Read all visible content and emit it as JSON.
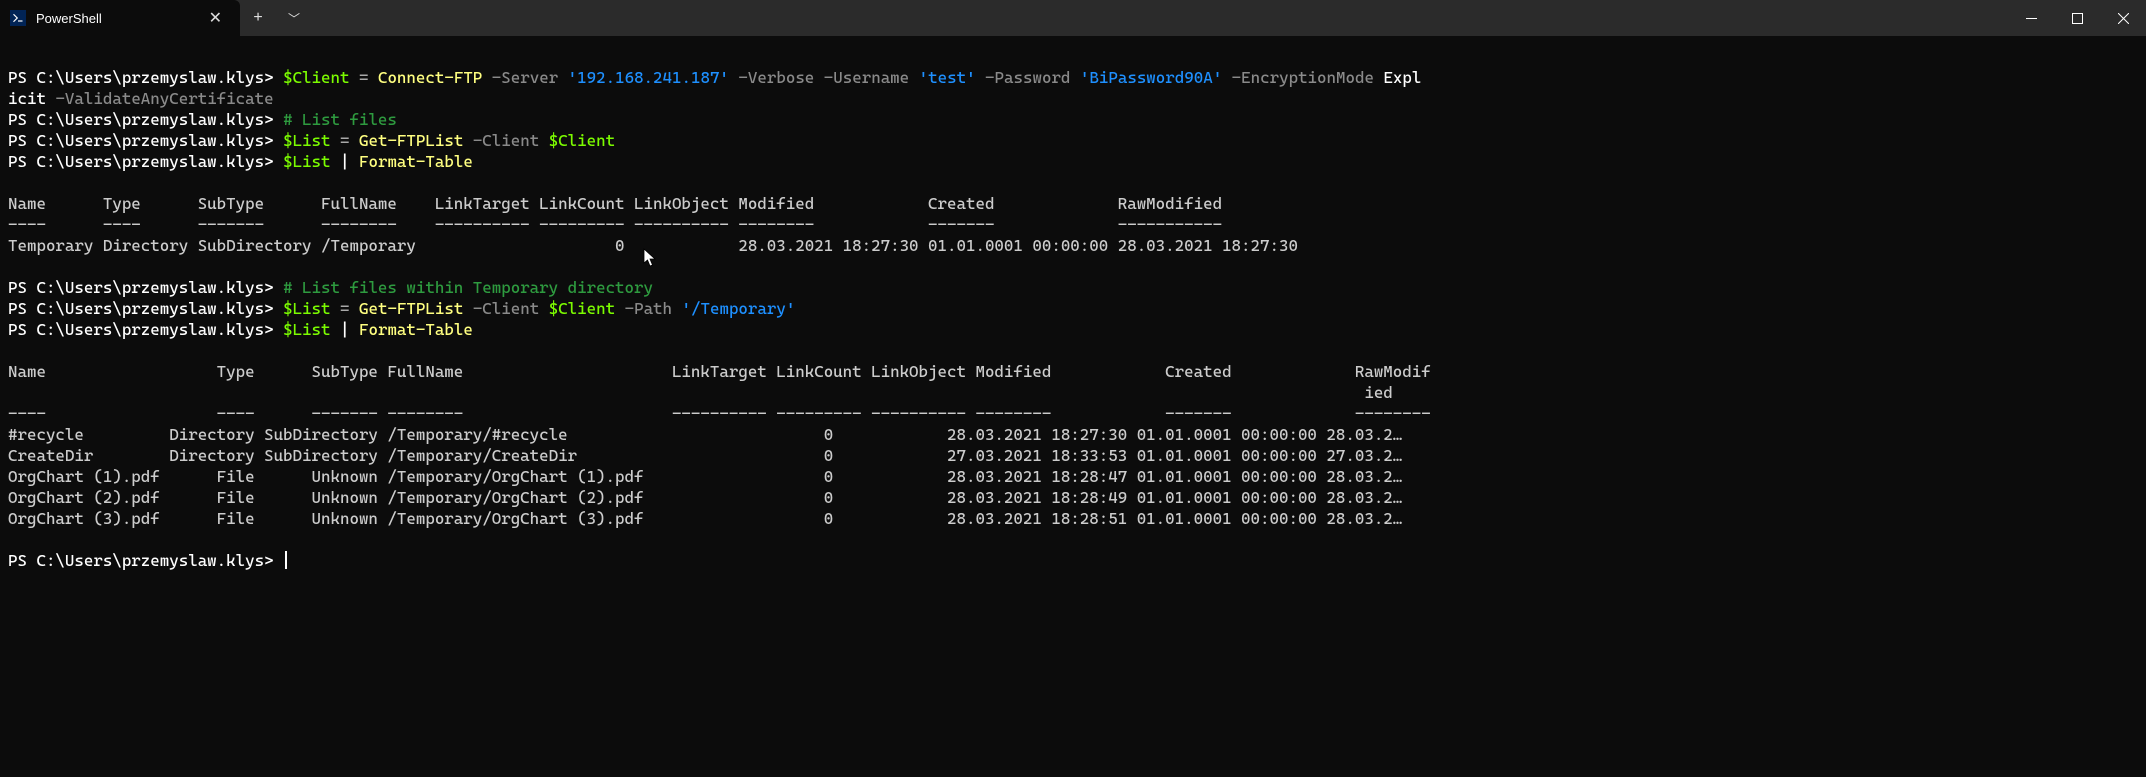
{
  "titlebar": {
    "tab_title": "PowerShell"
  },
  "prompt": "PS C:\\Users\\przemyslaw.klys>",
  "line1": {
    "var": "$Client",
    "eq": " = ",
    "cmd": "Connect-FTP",
    "p_server": " -Server ",
    "v_server": "'192.168.241.187'",
    "p_verbose": " -Verbose ",
    "p_user": "-Username ",
    "v_user": "'test'",
    "p_pass": " -Password ",
    "v_pass": "'BiPassword90A'",
    "p_enc": " -EncryptionMode ",
    "wrap1": "Expl",
    "wrap2": "icit",
    "p_validate": " -ValidateAnyCertificate"
  },
  "line2_comment": "# List files",
  "line3": {
    "var": "$List",
    "eq": " = ",
    "cmd": "Get-FTPList",
    "p_client": " -Client ",
    "v_client": "$Client"
  },
  "line4": {
    "var": "$List",
    "pipe": " | ",
    "cmd": "Format-Table"
  },
  "table1_header": "Name      Type      SubType      FullName    LinkTarget LinkCount LinkObject Modified            Created             RawModified",
  "table1_rule": "----      ----      -------      --------    ---------- --------- ---------- --------            -------             -----------",
  "table1_rows": [
    "Temporary Directory SubDirectory /Temporary                     0            28.03.2021 18:27:30 01.01.0001 00:00:00 28.03.2021 18:27:30"
  ],
  "line5_comment": "# List files within Temporary directory",
  "line6": {
    "var": "$List",
    "eq": " = ",
    "cmd": "Get-FTPList",
    "p_client": " -Client ",
    "v_client": "$Client",
    "p_path": " -Path ",
    "v_path": "'/Temporary'"
  },
  "line7": {
    "var": "$List",
    "pipe": " | ",
    "cmd": "Format-Table"
  },
  "table2_header": "Name                  Type      SubType FullName                      LinkTarget LinkCount LinkObject Modified            Created             RawModif\n                                                                                                                                               ied",
  "table2_rule": "----                  ----      ------- --------                      ---------- --------- ---------- --------            -------             --------",
  "table2_rows": [
    "#recycle         Directory SubDirectory /Temporary/#recycle                           0            28.03.2021 18:27:30 01.01.0001 00:00:00 28.03.2…",
    "CreateDir        Directory SubDirectory /Temporary/CreateDir                          0            27.03.2021 18:33:53 01.01.0001 00:00:00 27.03.2…",
    "OrgChart (1).pdf      File      Unknown /Temporary/OrgChart (1).pdf                   0            28.03.2021 18:28:47 01.01.0001 00:00:00 28.03.2…",
    "OrgChart (2).pdf      File      Unknown /Temporary/OrgChart (2).pdf                   0            28.03.2021 18:28:49 01.01.0001 00:00:00 28.03.2…",
    "OrgChart (3).pdf      File      Unknown /Temporary/OrgChart (3).pdf                   0            28.03.2021 18:28:51 01.01.0001 00:00:00 28.03.2…"
  ]
}
